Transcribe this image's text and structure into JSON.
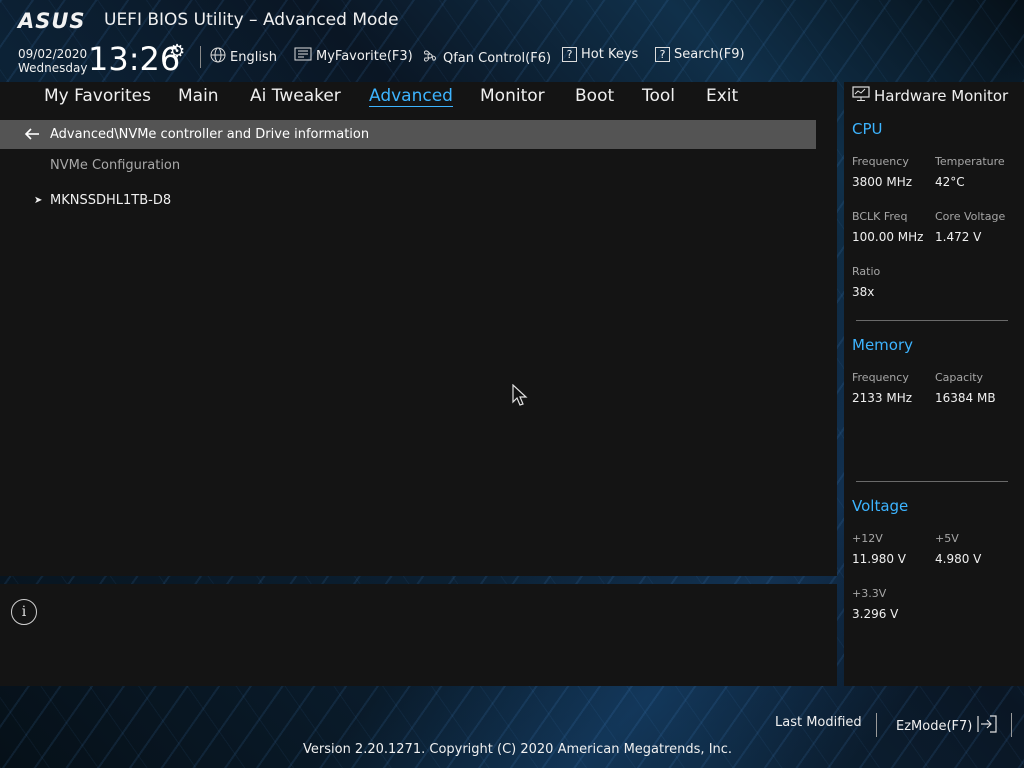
{
  "header": {
    "logo_text": "ASUS",
    "title": "UEFI BIOS Utility – Advanced Mode",
    "date": "09/02/2020",
    "weekday": "Wednesday",
    "time": "13:26",
    "tools": {
      "language": "English",
      "favorite": "MyFavorite(F3)",
      "qfan": "Qfan Control(F6)",
      "hotkeys": "Hot Keys",
      "search": "Search(F9)"
    }
  },
  "menu": {
    "items": [
      "My Favorites",
      "Main",
      "Ai Tweaker",
      "Advanced",
      "Monitor",
      "Boot",
      "Tool",
      "Exit"
    ],
    "active": "Advanced"
  },
  "content": {
    "path": "Advanced\\NVMe controller and Drive information",
    "section": "NVMe Configuration",
    "drive": "MKNSSDHL1TB-D8"
  },
  "hardware_monitor": {
    "title": "Hardware Monitor",
    "cpu": {
      "heading": "CPU",
      "frequency_label": "Frequency",
      "frequency": "3800 MHz",
      "temperature_label": "Temperature",
      "temperature": "42°C",
      "bclk_label": "BCLK Freq",
      "bclk": "100.00 MHz",
      "core_voltage_label": "Core Voltage",
      "core_voltage": "1.472 V",
      "ratio_label": "Ratio",
      "ratio": "38x"
    },
    "memory": {
      "heading": "Memory",
      "frequency_label": "Frequency",
      "frequency": "2133 MHz",
      "capacity_label": "Capacity",
      "capacity": "16384 MB"
    },
    "voltage": {
      "heading": "Voltage",
      "v12_label": "+12V",
      "v12": "11.980 V",
      "v5_label": "+5V",
      "v5": "4.980 V",
      "v33_label": "+3.3V",
      "v33": "3.296 V"
    }
  },
  "footer": {
    "last_modified": "Last Modified",
    "ezmode": "EzMode(F7)",
    "copyright": "Version 2.20.1271. Copyright (C) 2020 American Megatrends, Inc."
  },
  "colors": {
    "accent": "#3db4ff",
    "panel": "#141414",
    "path_bar": "#545454"
  },
  "icons": [
    "gear-icon",
    "globe-icon",
    "favorite-icon",
    "fan-icon",
    "question-icon",
    "search-help-icon",
    "back-arrow-icon",
    "expand-arrow-icon",
    "info-icon",
    "monitor-icon",
    "exit-icon"
  ]
}
